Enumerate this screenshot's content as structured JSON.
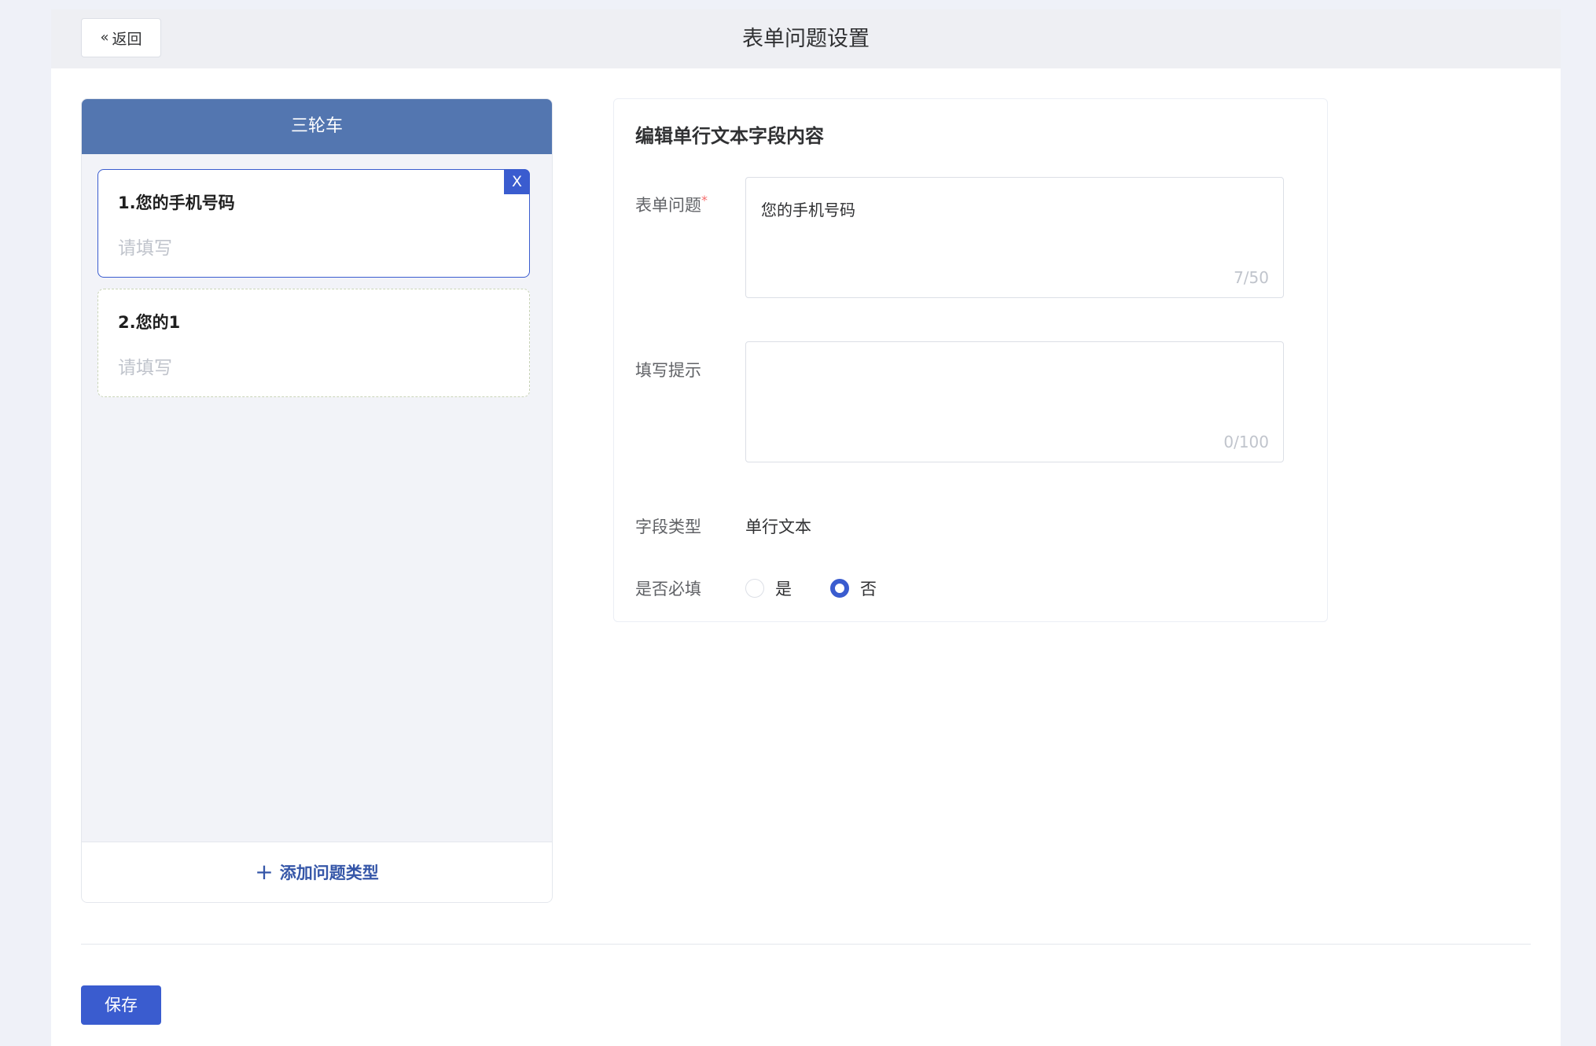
{
  "header": {
    "back_label": "返回",
    "title": "表单问题设置"
  },
  "left_panel": {
    "form_name": "三轮车",
    "questions": [
      {
        "title": "1.您的手机号码",
        "placeholder": "请填写"
      },
      {
        "title": "2.您的1",
        "placeholder": "请填写"
      }
    ],
    "close_label": "X",
    "add_label": "添加问题类型"
  },
  "editor": {
    "title": "编辑单行文本字段内容",
    "question_label": "表单问题",
    "question_required_mark": "*",
    "question_value": "您的手机号码",
    "question_count": "7/50",
    "hint_label": "填写提示",
    "hint_value": "",
    "hint_count": "0/100",
    "type_label": "字段类型",
    "type_value": "单行文本",
    "required_label": "是否必填",
    "required_options": [
      {
        "label": "是",
        "checked": false
      },
      {
        "label": "否",
        "checked": true
      }
    ]
  },
  "footer": {
    "save_label": "保存"
  },
  "colors": {
    "primary": "#3a5ccf",
    "panel_header": "#5376b0",
    "link": "#3556a8"
  }
}
